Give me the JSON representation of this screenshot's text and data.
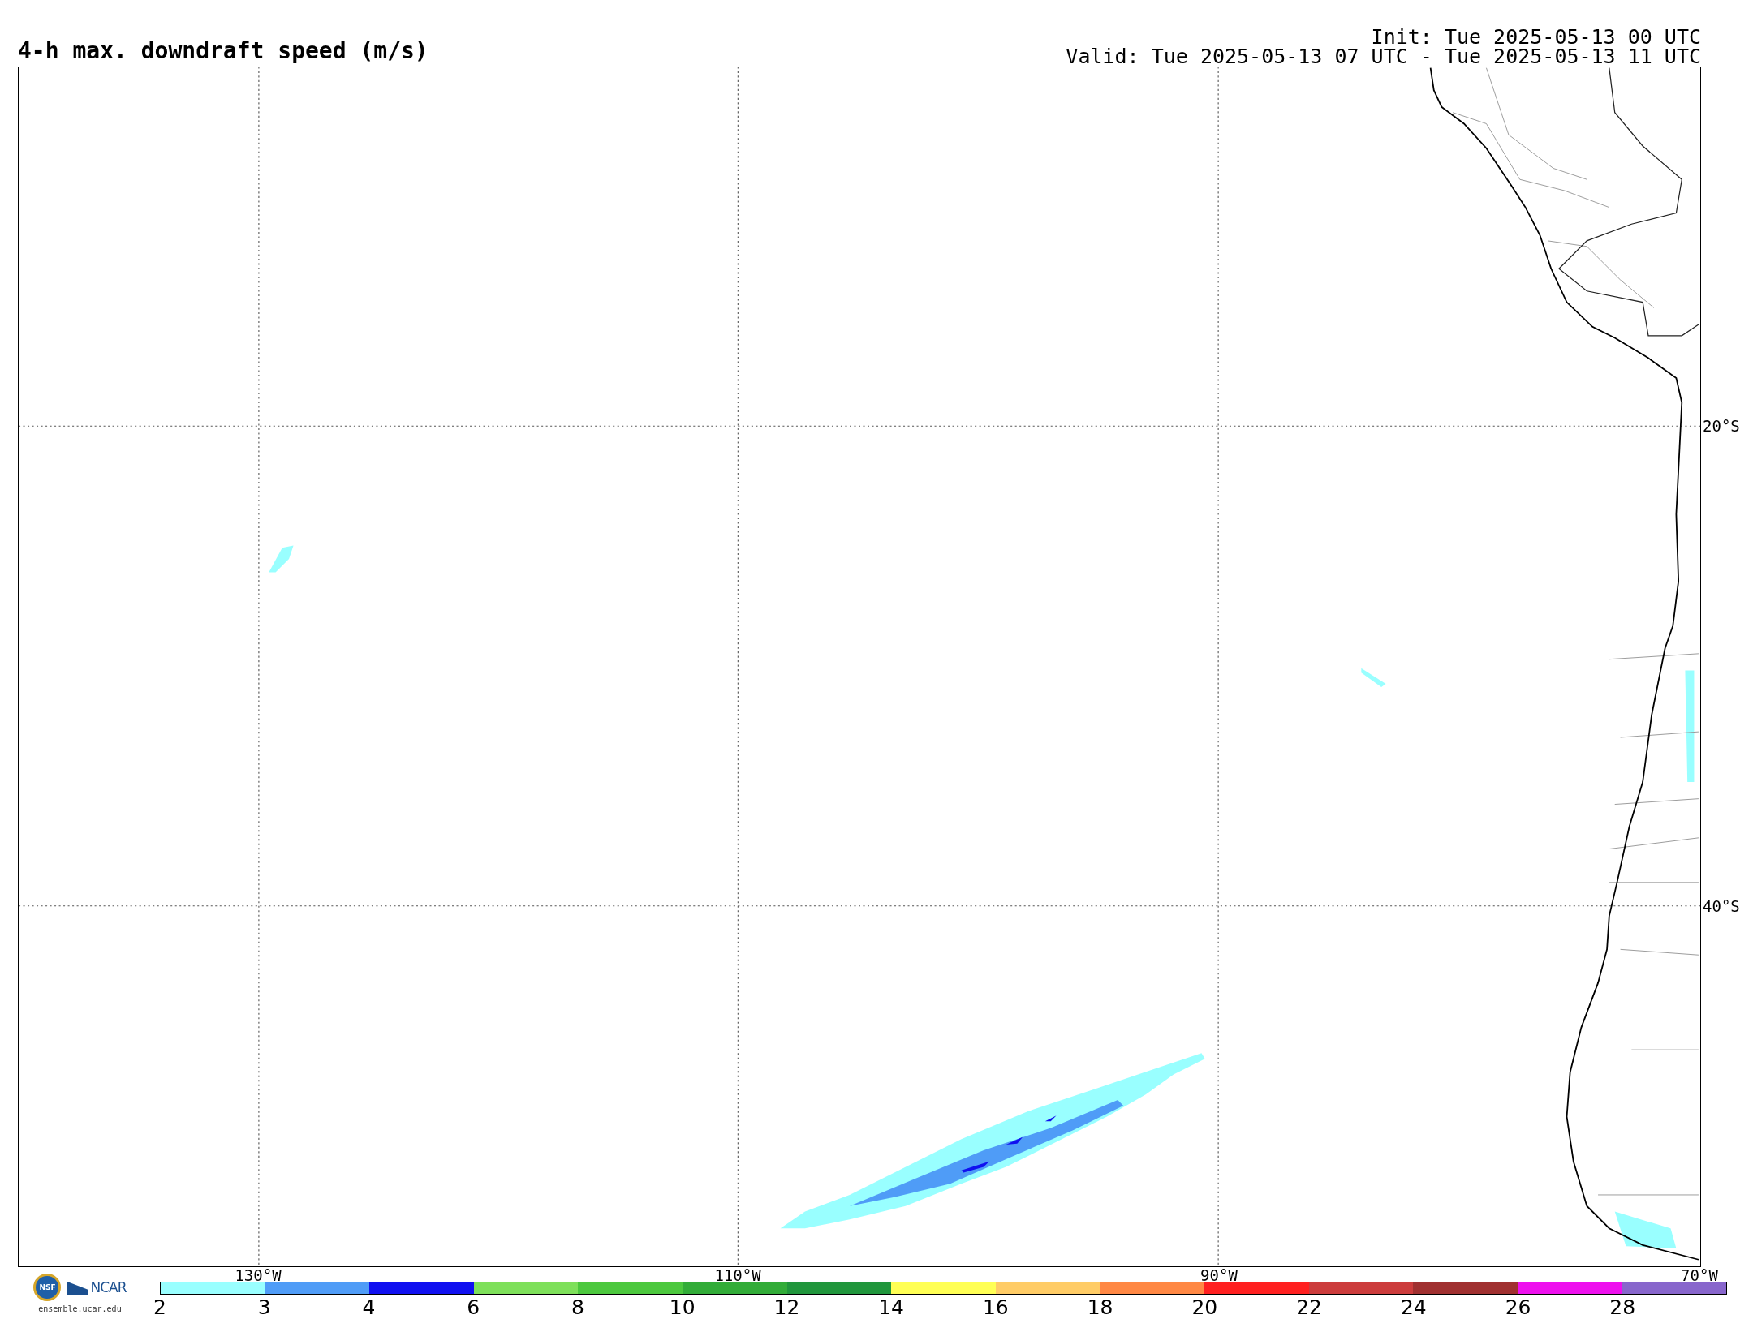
{
  "header": {
    "title": "4-h max. downdraft speed (m/s)",
    "init": "Init: Tue 2025-05-13 00 UTC",
    "valid": "Valid: Tue 2025-05-13 07 UTC - Tue 2025-05-13 11 UTC"
  },
  "map": {
    "lat_labels": [
      "20°S",
      "40°S"
    ],
    "lon_labels": [
      "130°W",
      "110°W",
      "90°W",
      "70°W"
    ]
  },
  "colorbar": {
    "ticks": [
      "2",
      "3",
      "4",
      "6",
      "8",
      "10",
      "12",
      "14",
      "16",
      "18",
      "20",
      "22",
      "24",
      "26",
      "28"
    ],
    "segments": [
      {
        "color": "#99ffff"
      },
      {
        "color": "#4f9cf7"
      },
      {
        "color": "#1010f0"
      },
      {
        "color": "#7ee05a"
      },
      {
        "color": "#4cc83e"
      },
      {
        "color": "#32ac38"
      },
      {
        "color": "#20963c"
      },
      {
        "color": "#ffff55"
      },
      {
        "color": "#ffcc66"
      },
      {
        "color": "#ff8844"
      },
      {
        "color": "#ff2020"
      },
      {
        "color": "#cc3c3c"
      },
      {
        "color": "#a03030"
      },
      {
        "color": "#ee10ee"
      },
      {
        "color": "#8866cc"
      }
    ]
  },
  "logo": {
    "nsf": "NSF",
    "ncar": "NCAR",
    "url": "ensemble.ucar.edu"
  }
}
